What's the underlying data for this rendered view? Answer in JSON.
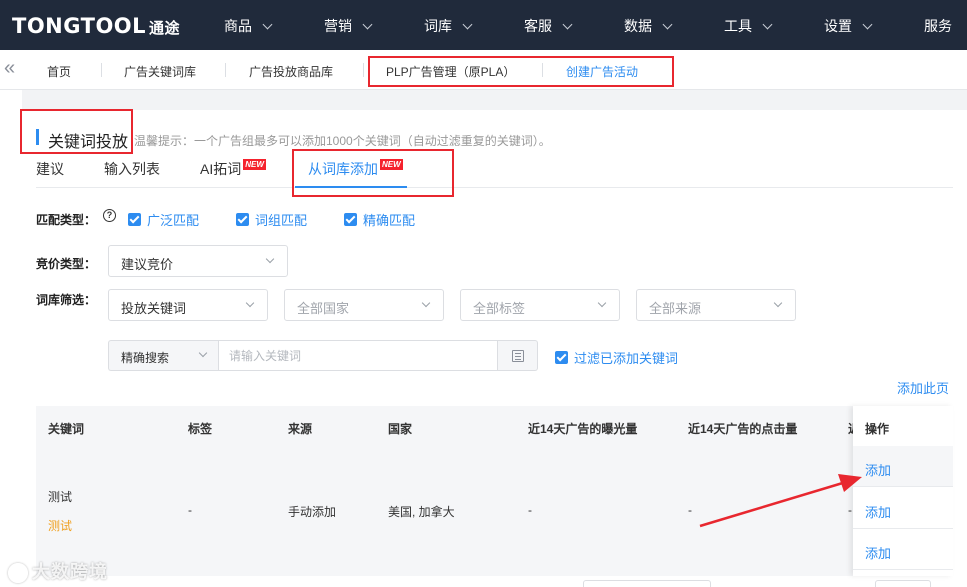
{
  "nav": {
    "logo": "TONGTOOL",
    "logo_cn": "通途",
    "items": [
      "商品",
      "营销",
      "词库",
      "客服",
      "数据",
      "工具",
      "设置",
      "服务"
    ]
  },
  "tabs": {
    "items": [
      "首页",
      "广告关键词库",
      "广告投放商品库",
      "PLP广告管理（原PLA）",
      "创建广告活动"
    ],
    "active_index": 4
  },
  "section": {
    "title": "关键词投放",
    "tip": "温馨提示：一个广告组最多可以添加1000个关键词（自动过滤重复的关键词）。"
  },
  "subtabs": {
    "items": [
      "建议",
      "输入列表",
      "AI拓词",
      "从词库添加"
    ],
    "new_badge": "NEW",
    "active_index": 3
  },
  "filters": {
    "match_type_label": "匹配类型：",
    "match_types": [
      "广泛匹配",
      "词组匹配",
      "精确匹配"
    ],
    "bid_type_label": "竞价类型：",
    "bid_type_value": "建议竞价",
    "library_label": "词库筛选：",
    "library_selects": [
      "投放关键词",
      "全部国家",
      "全部标签",
      "全部来源"
    ],
    "search_mode": "精确搜索",
    "search_placeholder": "请输入关键词",
    "filter_added_label": "过滤已添加关键词"
  },
  "add_page_link": "添加此页",
  "table": {
    "headers": [
      "关键词",
      "标签",
      "来源",
      "国家",
      "近14天广告的曝光量",
      "近14天广告的点击量",
      "近",
      "操作"
    ],
    "rows": [
      {
        "keyword": "测试",
        "keyword_tag": "测试",
        "tag": "-",
        "source": "手动添加",
        "country": "美国, 加拿大",
        "impressions": "-",
        "clicks": "-",
        "extra": "-",
        "action": "添加"
      }
    ],
    "more_actions": [
      "添加",
      "添加"
    ]
  },
  "watermark": "大数跨境",
  "colors": {
    "nav_bg": "#202a3b",
    "accent": "#2d8cf0",
    "annotation_red": "#e8272f",
    "tag_orange": "#f0a020"
  }
}
